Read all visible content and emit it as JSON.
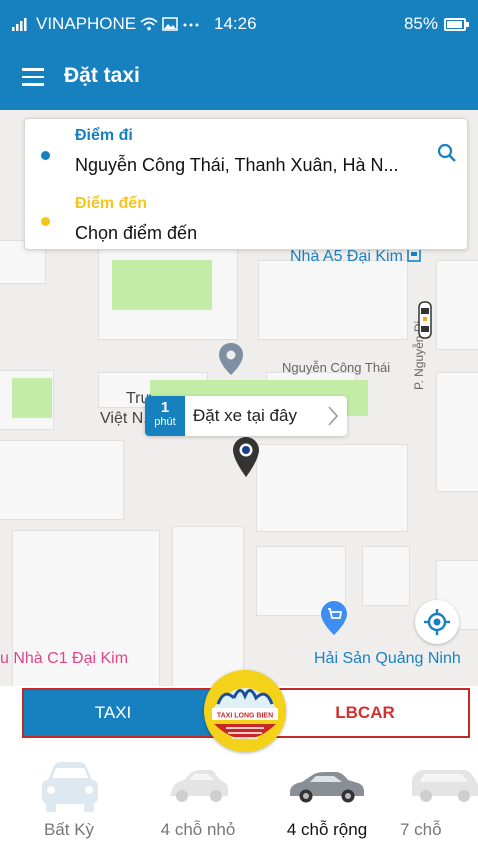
{
  "status_bar": {
    "carrier": "VINAPHONE",
    "time": "14:26",
    "battery": "85%"
  },
  "app_bar": {
    "title": "Đặt taxi"
  },
  "trip": {
    "origin_label": "Điểm đi",
    "origin_value": "Nguyễn Công Thái, Thanh Xuân, Hà N...",
    "destination_label": "Điểm đến",
    "destination_placeholder": "Chọn điểm đến"
  },
  "map": {
    "labels": {
      "poi_a5": "Nhà A5 Đại Kim",
      "street_nct": "Nguyễn Công Thái",
      "street_vertical": "P. Nguyễn Di",
      "school_line1": "Trư...",
      "school_line2": "Việt N...",
      "poi_c1": "u Nhà C1 Đại Kim",
      "poi_seafood": "Hải Sản Quảng Ninh"
    },
    "callout": {
      "minutes": "1",
      "unit": "phút",
      "text": "Đặt xe tại đây"
    }
  },
  "service_toggle": {
    "left": "TAXI",
    "right": "LBCAR",
    "logo_text": "TAXI LONG BIEN"
  },
  "car_types": [
    {
      "label": "Bất Kỳ"
    },
    {
      "label": "4 chỗ nhỏ"
    },
    {
      "label": "4 chỗ rộng"
    },
    {
      "label": "7 chỗ"
    }
  ],
  "colors": {
    "primary": "#1781bf",
    "origin_dot": "#1781bf",
    "destination": "#f5c518",
    "accent_red": "#d32f2f"
  },
  "icons": {
    "menu": "menu-icon",
    "search": "search-icon",
    "locate": "crosshair-icon",
    "pin": "map-pin-icon"
  }
}
